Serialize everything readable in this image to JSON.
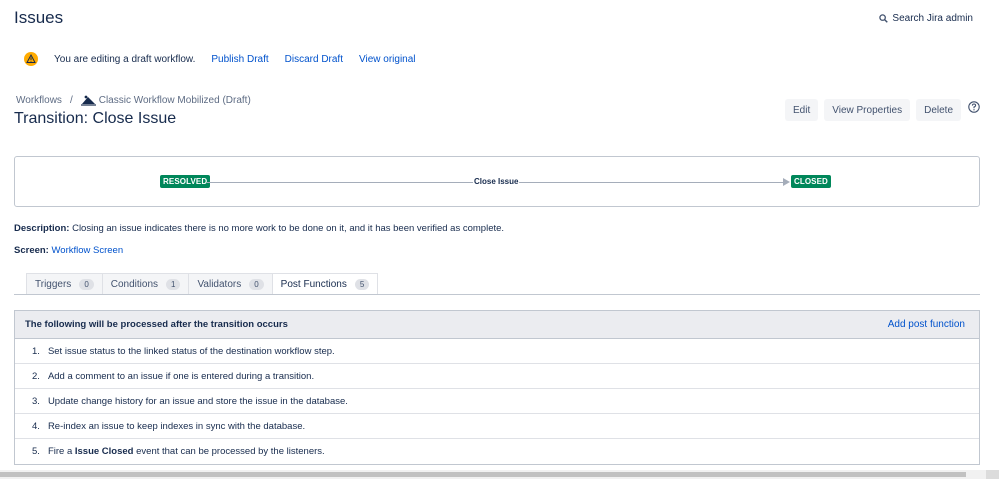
{
  "header": {
    "title": "Issues",
    "search_label": "Search Jira admin"
  },
  "draft": {
    "message": "You are editing a draft workflow.",
    "publish": "Publish Draft",
    "discard": "Discard Draft",
    "view_original": "View original"
  },
  "breadcrumb": {
    "root": "Workflows",
    "separator": "/",
    "workflow": "Classic Workflow Mobilized (Draft)"
  },
  "page_title": "Transition: Close Issue",
  "actions": {
    "edit": "Edit",
    "view_properties": "View Properties",
    "delete": "Delete"
  },
  "diagram": {
    "from_status": "RESOLVED",
    "transition": "Close Issue",
    "to_status": "CLOSED"
  },
  "description": {
    "label": "Description:",
    "text": "Closing an issue indicates there is no more work to be done on it, and it has been verified as complete."
  },
  "screen": {
    "label": "Screen:",
    "value": "Workflow Screen"
  },
  "tabs": [
    {
      "label": "Triggers",
      "count": "0"
    },
    {
      "label": "Conditions",
      "count": "1"
    },
    {
      "label": "Validators",
      "count": "0"
    },
    {
      "label": "Post Functions",
      "count": "5"
    }
  ],
  "post_functions": {
    "title": "The following will be processed after the transition occurs",
    "add_link": "Add post function",
    "items": [
      {
        "num": "1.",
        "text": "Set issue status to the linked status of the destination workflow step."
      },
      {
        "num": "2.",
        "text": "Add a comment to an issue if one is entered during a transition."
      },
      {
        "num": "3.",
        "text": "Update change history for an issue and store the issue in the database."
      },
      {
        "num": "4.",
        "text": "Re-index an issue to keep indexes in sync with the database."
      },
      {
        "num": "5.",
        "pre": "Fire a ",
        "bold": "Issue Closed",
        "post": " event that can be processed by the listeners."
      }
    ]
  },
  "colors": {
    "link": "#0052cc",
    "status_green": "#00875a",
    "warning": "#ffab00"
  }
}
